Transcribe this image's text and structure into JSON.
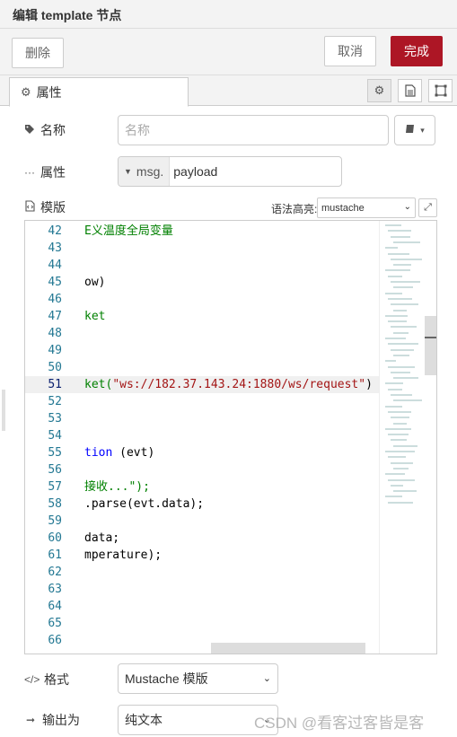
{
  "header": {
    "title": "编辑 template 节点"
  },
  "toolbar": {
    "delete_label": "删除",
    "cancel_label": "取消",
    "done_label": "完成"
  },
  "tabs": {
    "properties_label": "属性"
  },
  "form": {
    "name": {
      "label": "名称",
      "placeholder": "名称"
    },
    "property": {
      "label": "属性",
      "type": "msg.",
      "value": "payload"
    },
    "template": {
      "label": "模版",
      "syntax_label": "语法高亮:",
      "syntax_value": "mustache"
    },
    "format": {
      "label": "格式",
      "value": "Mustache 模版"
    },
    "output": {
      "label": "输出为",
      "value": "纯文本"
    }
  },
  "editor": {
    "lines": [
      {
        "num": "42",
        "text": "E义温度全局变量",
        "color": "green"
      },
      {
        "num": "43",
        "text": "",
        "color": "black"
      },
      {
        "num": "44",
        "text": "",
        "color": "black"
      },
      {
        "num": "45",
        "text": "ow)",
        "color": "black"
      },
      {
        "num": "46",
        "text": "",
        "color": "black"
      },
      {
        "num": "47",
        "text": "ket",
        "color": "green"
      },
      {
        "num": "48",
        "text": "",
        "color": "black"
      },
      {
        "num": "49",
        "text": "",
        "color": "black"
      },
      {
        "num": "50",
        "text": "",
        "color": "black"
      },
      {
        "num": "51",
        "pre": "ket(",
        "str": "\"ws://182.37.143.24:1880/ws/request\"",
        "post": ")",
        "active": true
      },
      {
        "num": "52",
        "text": "",
        "color": "black"
      },
      {
        "num": "53",
        "text": "",
        "color": "black"
      },
      {
        "num": "54",
        "text": "",
        "color": "black"
      },
      {
        "num": "55",
        "kw": "tion",
        "rest": " (evt)"
      },
      {
        "num": "56",
        "text": "",
        "color": "black"
      },
      {
        "num": "57",
        "text": "接收...\");",
        "color": "green"
      },
      {
        "num": "58",
        "text": ".parse(evt.data);",
        "color": "black"
      },
      {
        "num": "59",
        "text": "",
        "color": "black"
      },
      {
        "num": "60",
        "text": "data;",
        "color": "black"
      },
      {
        "num": "61",
        "text": "mperature);",
        "color": "black"
      },
      {
        "num": "62",
        "text": "",
        "color": "black"
      },
      {
        "num": "63",
        "text": "",
        "color": "black"
      },
      {
        "num": "64",
        "text": "",
        "color": "black"
      },
      {
        "num": "65",
        "text": "",
        "color": "black"
      },
      {
        "num": "66",
        "text": "",
        "color": "black"
      }
    ]
  },
  "watermark": "CSDN @看客过客皆是客",
  "colors": {
    "primary": "#ad1625",
    "line_number": "#237893",
    "string": "#a31515",
    "keyword": "#0000ff",
    "comment": "#008000"
  }
}
